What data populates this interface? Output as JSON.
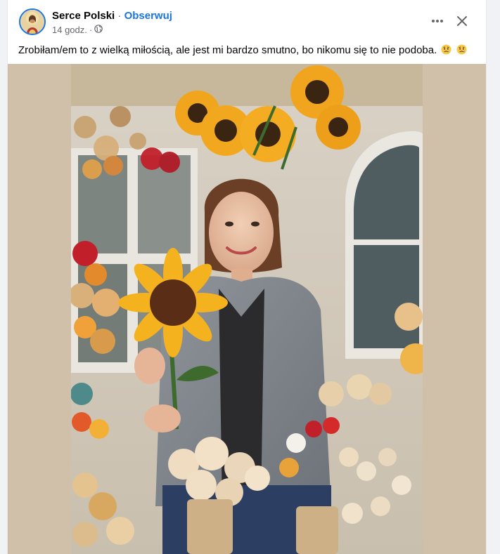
{
  "post": {
    "author": "Serce Polski",
    "separator": "·",
    "follow_label": "Obserwuj",
    "timestamp": "14 godz.",
    "meta_separator": "·",
    "privacy_icon": "globe-icon",
    "text": "Zrobiłam/em to z wielką miłością, ale jest mi bardzo smutno, bo nikomu się to nie podoba.",
    "emojis": [
      "sad-relieved-face-emoji",
      "sad-relieved-face-emoji"
    ]
  },
  "actions": {
    "more_icon": "more-options-icon",
    "close_icon": "close-icon"
  },
  "colors": {
    "accent": "#1b74e4",
    "text_primary": "#050505",
    "text_secondary": "#65676b",
    "media_background": "#d0bfa9"
  },
  "media": {
    "type": "photo",
    "subject": "woman holding a crocheted sunflower at a flower stall"
  }
}
